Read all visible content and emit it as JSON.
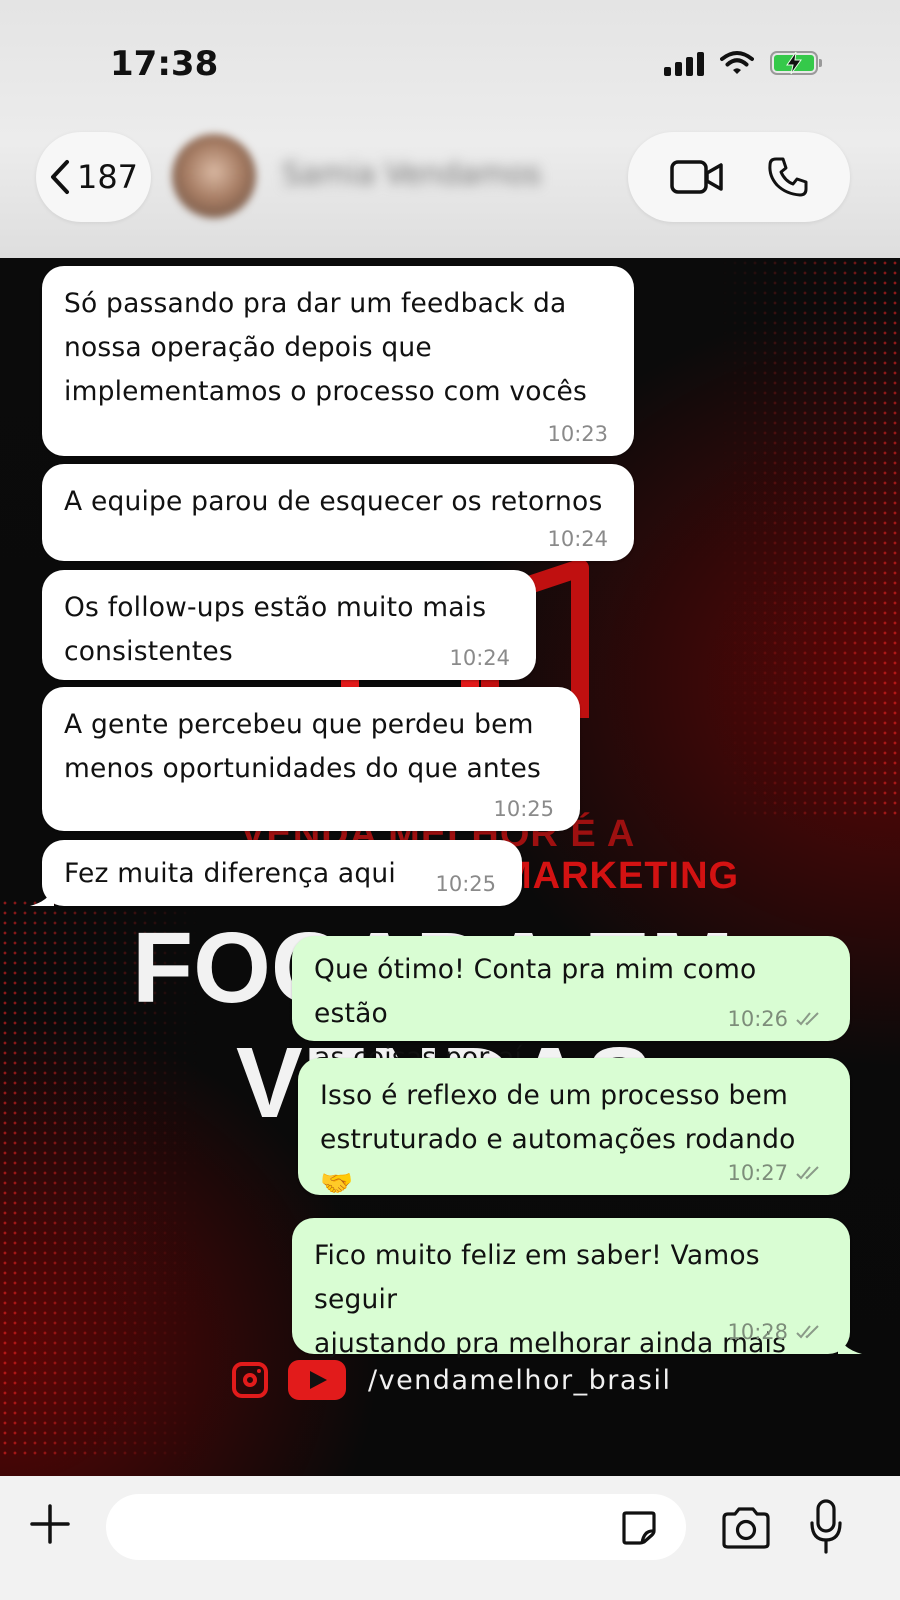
{
  "status_bar": {
    "time": "17:38",
    "icons": [
      "cellular-signal-icon",
      "wifi-icon",
      "battery-charging-icon"
    ]
  },
  "header": {
    "back_count": "187",
    "contact_name": "Samia Vendamos",
    "actions": [
      "video-call-icon",
      "voice-call-icon"
    ]
  },
  "wallpaper": {
    "tag_line_1": "VENDA MELHOR É A",
    "tag_line_2": "MARKETING",
    "big_line_1": "FOCADA EM",
    "big_line_2": "VENDAS",
    "handle": "/vendamelhor_brasil",
    "accent_color": "#e21b1b"
  },
  "messages": [
    {
      "direction": "in",
      "text": "Só passando pra dar um feedback da\nnossa operação depois que\nimplementamos o processo com vocês",
      "time": "10:23"
    },
    {
      "direction": "in",
      "text": "A equipe parou de esquecer os retornos",
      "time": "10:24"
    },
    {
      "direction": "in",
      "text": "Os follow-ups estão muito mais\nconsistentes",
      "time": "10:24"
    },
    {
      "direction": "in",
      "text": "A gente percebeu que perdeu bem\nmenos oportunidades do que antes",
      "time": "10:25"
    },
    {
      "direction": "in",
      "text": "Fez muita diferença aqui",
      "time": "10:25"
    },
    {
      "direction": "out",
      "text": "Que ótimo! Conta pra mim como estão\nas coisas por aí",
      "time": "10:26",
      "read": true
    },
    {
      "direction": "out",
      "text": "Isso é reflexo de um processo bem\nestruturado e automações rodando 🤝",
      "time": "10:27",
      "read": true
    },
    {
      "direction": "out",
      "text": "Fico muito feliz em saber! Vamos seguir\najustando pra melhorar ainda mais",
      "time": "10:28",
      "read": true
    }
  ],
  "composer": {
    "placeholder": "",
    "icons": [
      "plus-icon",
      "sticker-icon",
      "camera-icon",
      "microphone-icon"
    ]
  },
  "colors": {
    "incoming_bubble": "#ffffff",
    "outgoing_bubble": "#d9fdd3",
    "wallpaper": "#0b0b0b"
  }
}
